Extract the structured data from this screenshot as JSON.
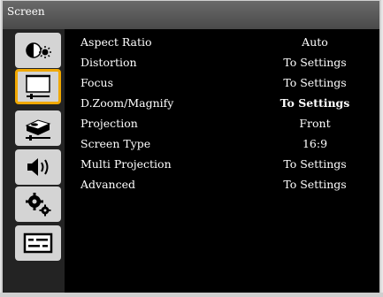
{
  "window": {
    "title": "Screen"
  },
  "sidebar": {
    "items": [
      {
        "icon": "brightness-contrast-icon",
        "selected": false
      },
      {
        "icon": "screen-icon",
        "selected": true
      },
      {
        "icon": "projector-setup-icon",
        "selected": false
      },
      {
        "icon": "volume-icon",
        "selected": false
      },
      {
        "icon": "gears-icon",
        "selected": false
      },
      {
        "icon": "options-panel-icon",
        "selected": false
      }
    ]
  },
  "menu": {
    "rows": [
      {
        "label": "Aspect Ratio",
        "value": "Auto"
      },
      {
        "label": "Distortion",
        "value": "To Settings"
      },
      {
        "label": "Focus",
        "value": "To Settings"
      },
      {
        "label": "D.Zoom/Magnify",
        "value": "To Settings"
      },
      {
        "label": "Projection",
        "value": "Front"
      },
      {
        "label": "Screen Type",
        "value": "16:9"
      },
      {
        "label": "Multi Projection",
        "value": "To Settings"
      },
      {
        "label": "Advanced",
        "value": "To Settings"
      }
    ]
  },
  "colors": {
    "selection": "#f0a800",
    "title_bar": "#5a5a5a",
    "panel": "#000000"
  }
}
